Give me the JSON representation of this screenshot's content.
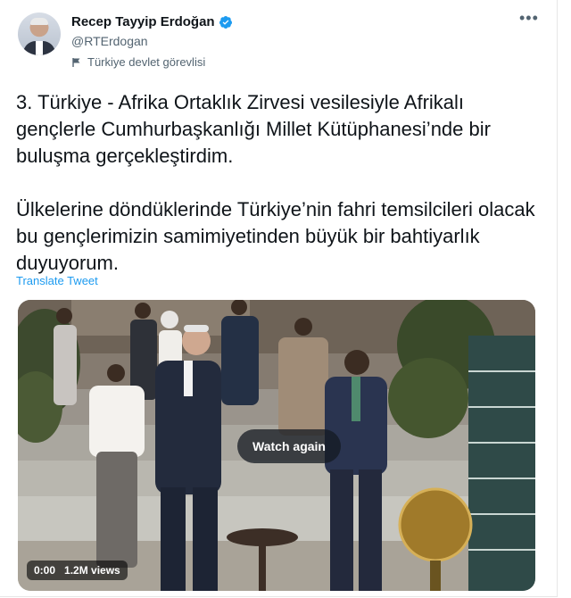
{
  "author": {
    "name": "Recep Tayyip Erdoğan",
    "handle": "@RTErdogan",
    "label": "Türkiye devlet görevlisi"
  },
  "tweet": {
    "paragraph1": "3. Türkiye - Afrika Ortaklık Zirvesi vesilesiyle Afrikalı gençlerle Cumhurbaşkanlığı Millet Kütüphanesi’nde bir buluşma gerçekleştirdim.",
    "paragraph2": "Ülkelerine döndüklerinde Türkiye’nin fahri temsilcileri olacak bu gençlerimizin samimiyetinden büyük bir bahtiyarlık duyuyorum.",
    "translate_label": "Translate Tweet"
  },
  "video": {
    "watch_again_label": "Watch again",
    "time": "0:00",
    "views": "1.2M views"
  },
  "icons": {
    "verified": "verified-badge-icon",
    "label": "flag-icon",
    "more": "more-options-icon"
  },
  "colors": {
    "accent": "#1d9bf0",
    "text": "#0f1419",
    "secondary": "#536471"
  }
}
